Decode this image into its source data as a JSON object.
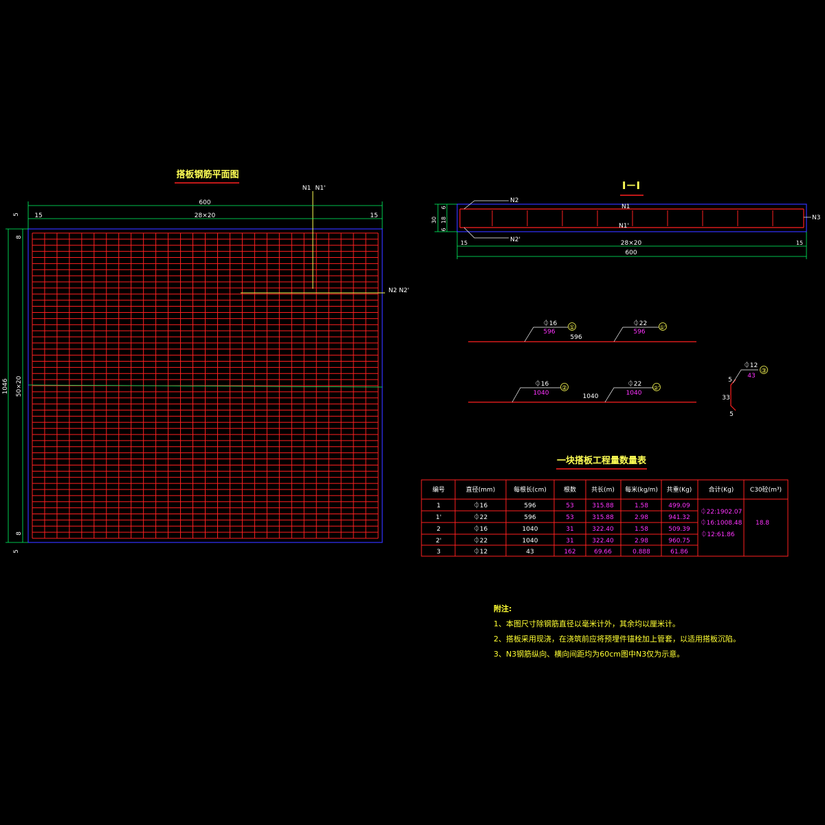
{
  "colors": {
    "background": "#000000",
    "rebar": "#ff2020",
    "outline": "#3333ff",
    "dimension": "#00ff66",
    "label_yellow": "#ffff55",
    "label_white": "#ffffff",
    "label_magenta": "#ff33ff",
    "table_border": "#ff2020"
  },
  "plan": {
    "title": "搭板钢筋平面图",
    "dim_total_width": "600",
    "dim_side_left": "15",
    "dim_side_right": "15",
    "dim_spacing": "28×20",
    "dim_top_offset": "5",
    "dim_edge_top": "8",
    "dim_total_height": "1046",
    "dim_spacing_vertical": "50×20",
    "dim_edge_bottom": "8",
    "dim_bottom_offset": "5",
    "label_n1": "N1",
    "label_n1p": "N1'",
    "label_n2": "N2 N2'"
  },
  "section": {
    "title": "Ⅰ－Ⅰ",
    "label_n2": "N2",
    "label_n1": "N1",
    "label_n1p": "N1'",
    "label_n2p": "N2'",
    "label_n3": "N3",
    "dim_depth": "30",
    "dim_cover_top": "6",
    "dim_inner": "18",
    "dim_cover_bottom": "6",
    "dim_side_left": "15",
    "dim_spacing": "28×20",
    "dim_side_right": "15",
    "dim_total": "600"
  },
  "bars": [
    {
      "diameter": "⏀16",
      "length": "596",
      "marker": "①",
      "span": "596"
    },
    {
      "diameter": "⏀22",
      "length": "596",
      "marker": "①'"
    },
    {
      "diameter": "⏀16",
      "length": "1040",
      "marker": "②",
      "span": "1040"
    },
    {
      "diameter": "⏀22",
      "length": "1040",
      "marker": "②'"
    },
    {
      "diameter": "⏀12",
      "length": "43",
      "marker": "③",
      "leg_top": "5",
      "leg_mid": "33",
      "leg_bottom": "5"
    }
  ],
  "table": {
    "title": "一块搭板工程量数量表",
    "headers": [
      "编号",
      "直径(mm)",
      "每根长(cm)",
      "根数",
      "共长(m)",
      "每米(kg/m)",
      "共重(Kg)",
      "合计(Kg)",
      "C30砼(m³)"
    ],
    "rows": [
      [
        "1",
        "⏀16",
        "596",
        "53",
        "315.88",
        "1.58",
        "499.09"
      ],
      [
        "1'",
        "⏀22",
        "596",
        "53",
        "315.88",
        "2.98",
        "941.32"
      ],
      [
        "2",
        "⏀16",
        "1040",
        "31",
        "322.40",
        "1.58",
        "509.39"
      ],
      [
        "2'",
        "⏀22",
        "1040",
        "31",
        "322.40",
        "2.98",
        "960.75"
      ],
      [
        "3",
        "⏀12",
        "43",
        "162",
        "69.66",
        "0.888",
        "61.86"
      ]
    ],
    "totals": [
      "⏀22:1902.07",
      "⏀16:1008.48",
      "⏀12:61.86"
    ],
    "concrete": "18.8"
  },
  "notes": {
    "heading": "附注:",
    "items": [
      "1、本图尺寸除钢筋直径以毫米计外，其余均以厘米计。",
      "2、搭板采用现浇，在浇筑前应将预埋件锚栓加上管套，以适用搭板沉陷。",
      "3、N3钢筋纵向、横向间距均为60cm图中N3仅为示意。"
    ]
  }
}
